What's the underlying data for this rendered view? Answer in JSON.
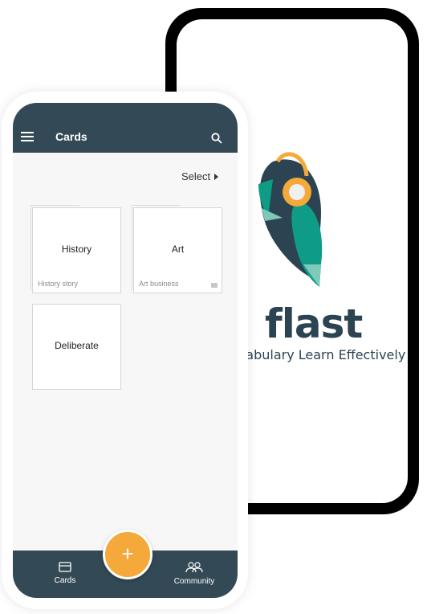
{
  "splash": {
    "brand": "flast",
    "tagline": "Vocabulary Learn Effectively",
    "colors": {
      "teal": "#0e9c86",
      "navy": "#2c4452",
      "orange": "#f4a93a"
    }
  },
  "app": {
    "title": "Cards",
    "select_label": "Select",
    "cards": [
      {
        "title": "History",
        "subtitle": "History story"
      },
      {
        "title": "Art",
        "subtitle": "Art business"
      },
      {
        "title": "Deliberate",
        "subtitle": ""
      }
    ],
    "fab_label": "+",
    "nav": {
      "cards_label": "Cards",
      "community_label": "Community"
    },
    "colors": {
      "appbar": "#334a56",
      "fab": "#f4a93a",
      "background": "#f7f7f7"
    }
  }
}
